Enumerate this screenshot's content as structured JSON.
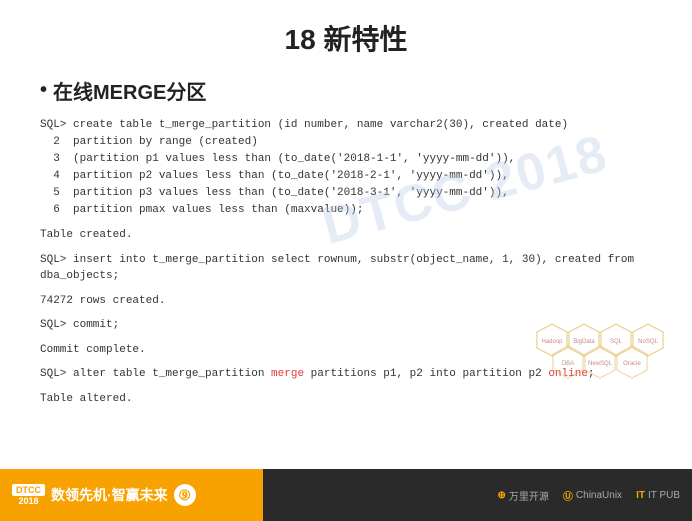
{
  "slide": {
    "title": "18  新特性",
    "section": "在线MERGE分区",
    "bullet": "•",
    "watermark": "DTCC 2018",
    "code_block_1": {
      "lines": [
        "SQL> create table t_merge_partition (id number, name varchar2(30), created date)",
        "  2  partition by range (created)",
        "  3  (partition p1 values less than (to_date('2018-1-1', 'yyyy-mm-dd')),",
        "  4  partition p2 values less than (to_date('2018-2-1', 'yyyy-mm-dd')),",
        "  5  partition p3 values less than (to_date('2018-3-1', 'yyyy-mm-dd')),",
        "  6  partition pmax values less than (maxvalue));"
      ]
    },
    "table_created_1": "Table created.",
    "code_block_2": "SQL> insert into t_merge_partition select rownum, substr(object_name, 1, 30), created from dba_objects;",
    "rows_created": "74272 rows created.",
    "code_block_3": "SQL> commit;",
    "commit_complete": "Commit complete.",
    "code_block_4_prefix": "SQL> alter table t_merge_partition ",
    "code_block_4_merge": "merge",
    "code_block_4_middle": " partitions p1, p2 into partition p2 ",
    "code_block_4_online": "online",
    "code_block_4_suffix": ";",
    "table_altered": "Table altered."
  },
  "footer": {
    "dtcc_label": "DTCC",
    "year_label": "2018",
    "tagline": "数领先机·智赢未来",
    "gear_icon": "⑨",
    "logo1": "万里开源",
    "logo2": "ChinaUnix",
    "logo3": "IT PUB",
    "hex_labels": [
      "Hadoop",
      "BigData",
      "SQL",
      "NoSQL",
      "DBA",
      "NewSQL"
    ]
  },
  "colors": {
    "title": "#222222",
    "code": "#333333",
    "highlight": "#e63a3a",
    "footer_orange": "#f7a200",
    "footer_dark": "#2a2a2a",
    "watermark": "rgba(180,200,230,0.35)"
  }
}
